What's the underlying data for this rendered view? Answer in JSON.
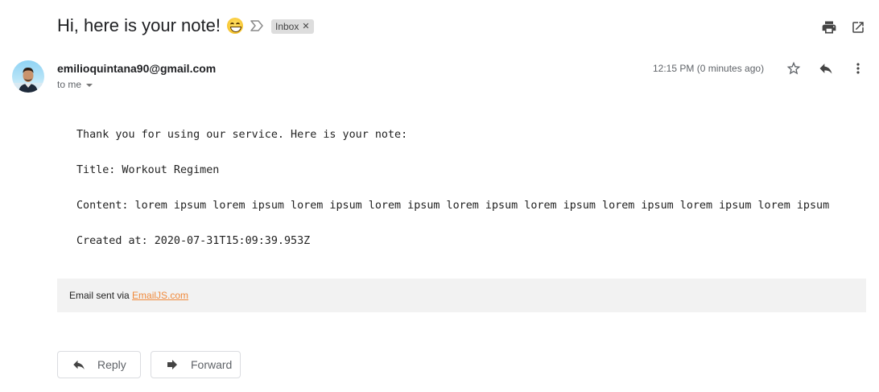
{
  "message": {
    "subject": "Hi, here is your note!",
    "subject_emoji": "grinning-face-with-smiling-eyes",
    "label": "Inbox",
    "sender": "emilioquintana90@gmail.com",
    "recipient_label": "to me",
    "time": "12:15 PM (0 minutes ago)"
  },
  "body": {
    "intro": "Thank you for using our service. Here is your note:",
    "title_line": "Title: Workout Regimen",
    "content_line": "Content: lorem ipsum lorem ipsum lorem ipsum lorem ipsum lorem ipsum lorem ipsum lorem ipsum lorem ipsum lorem ipsum",
    "created_line": "Created at: 2020-07-31T15:09:39.953Z"
  },
  "footer": {
    "prefix": "Email sent via ",
    "link_text": "EmailJS.com"
  },
  "actions": {
    "reply_label": "Reply",
    "forward_label": "Forward"
  },
  "icons": {
    "importance": "importance-marker-icon",
    "print": "print-icon",
    "popout": "open-in-new-window-icon",
    "star": "star-icon",
    "reply": "reply-icon",
    "more": "more-vert-icon",
    "forward": "forward-icon"
  },
  "colors": {
    "link": "#f08a3c",
    "footer_bg": "#f2f2f2",
    "label_chip_bg": "#dddddd"
  }
}
